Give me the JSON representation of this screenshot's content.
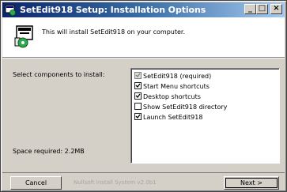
{
  "window": {
    "title": "SetEdit918 Setup: Installation Options",
    "controls": {
      "minimize": "_",
      "maximize": "□",
      "close": "×"
    }
  },
  "header": {
    "text": "This will install SetEdit918 on your computer."
  },
  "labels": {
    "select_components": "Select components to install:",
    "space_required": "Space required: 2.2MB"
  },
  "components": [
    {
      "label": "SetEdit918 (required)",
      "checked": true,
      "disabled": true
    },
    {
      "label": "Start Menu shortcuts",
      "checked": true,
      "disabled": false
    },
    {
      "label": "Desktop shortcuts",
      "checked": true,
      "disabled": false
    },
    {
      "label": "Show SetEdit918 directory",
      "checked": false,
      "disabled": false
    },
    {
      "label": "Launch SetEdit918",
      "checked": true,
      "disabled": false
    }
  ],
  "footer": {
    "cancel": "Cancel",
    "branding": "Nullsoft Install System v2.0b1",
    "next": "Next >"
  },
  "colors": {
    "face": "#d4d0c8",
    "title_start": "#0a246a",
    "title_end": "#a6caf0"
  }
}
